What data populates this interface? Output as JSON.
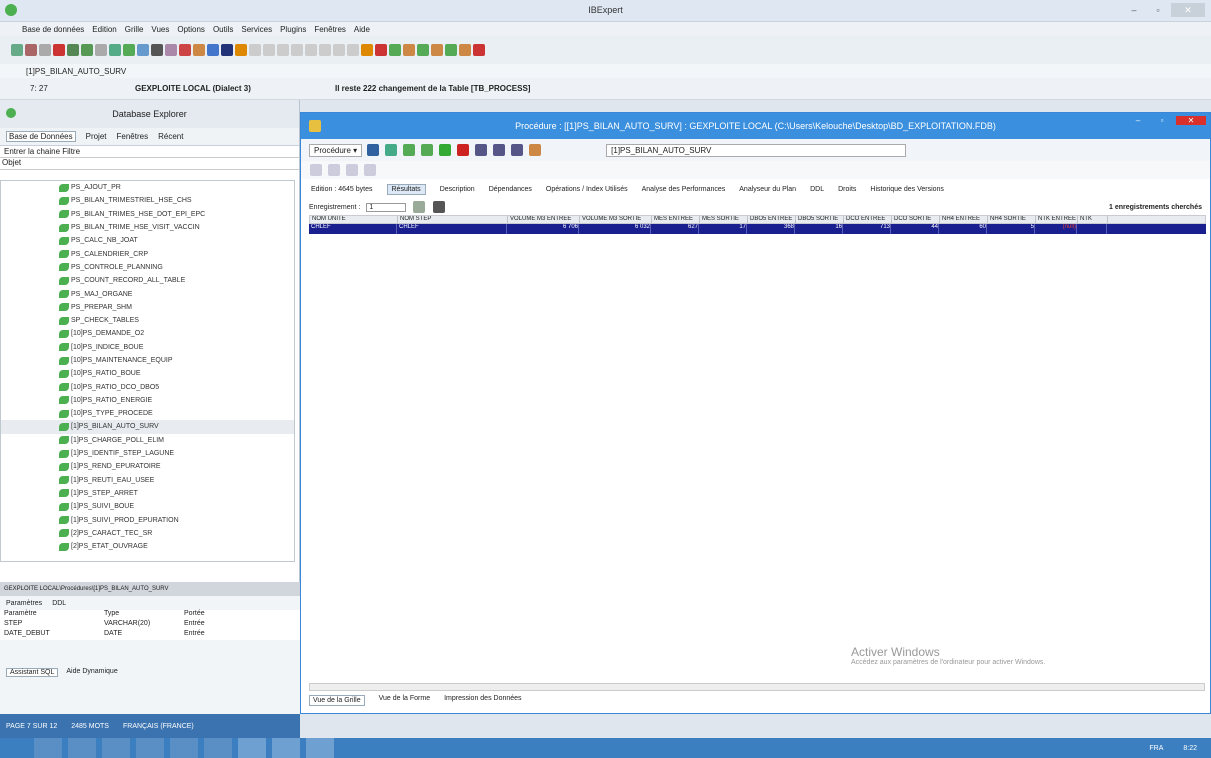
{
  "app": {
    "title": "IBExpert"
  },
  "menu": [
    "Base de données",
    "Edition",
    "Grille",
    "Vues",
    "Options",
    "Outils",
    "Services",
    "Plugins",
    "Fenêtres",
    "Aide"
  ],
  "proc_strip": "[1]PS_BILAN_AUTO_SURV",
  "status_top": {
    "pos": "7: 27",
    "db": "GEXPLOITE LOCAL (Dialect 3)",
    "msg": "Il reste 222 changement de la Table [TB_PROCESS]"
  },
  "dbx": {
    "title": "Database Explorer",
    "tabs": [
      "Base de Données",
      "Projet",
      "Fenêtres",
      "Récent"
    ],
    "filter": "Entrer la chaine Filtre",
    "object_label": "Objet",
    "items": [
      "PS_AJOUT_PR",
      "PS_BILAN_TRIMESTRIEL_HSE_CHS",
      "PS_BILAN_TRIMES_HSE_DOT_EPI_EPC",
      "PS_BILAN_TRIME_HSE_VISIT_VACCIN",
      "PS_CALC_NB_JOAT",
      "PS_CALENDRIER_CRP",
      "PS_CONTROLE_PLANNING",
      "PS_COUNT_RECORD_ALL_TABLE",
      "PS_MAJ_ORGANE",
      "PS_PREPAR_SHM",
      "SP_CHECK_TABLES",
      "[10]PS_DEMANDE_O2",
      "[10]PS_INDICE_BOUE",
      "[10]PS_MAINTENANCE_EQUIP",
      "[10]PS_RATIO_BOUE",
      "[10]PS_RATIO_DCO_DBO5",
      "[10]PS_RATIO_ENERGIE",
      "[10]PS_TYPE_PROCEDE",
      "[1]PS_BILAN_AUTO_SURV",
      "[1]PS_CHARGE_POLL_ELIM",
      "[1]PS_IDENTIF_STEP_LAGUNE",
      "[1]PS_REND_EPURATOIRE",
      "[1]PS_REUTI_EAU_USEE",
      "[1]PS_STEP_ARRET",
      "[1]PS_SUIVI_BOUE",
      "[1]PS_SUIVI_PROD_EPURATION",
      "[2]PS_CARACT_TEC_SR",
      "[2]PS_ETAT_OUVRAGE"
    ],
    "selected_index": 18
  },
  "params": {
    "path": "GEXPLOITE LOCAL\\Procédures\\[1]PS_BILAN_AUTO_SURV",
    "tabs": [
      "Paramètres",
      "DDL"
    ],
    "headers": [
      "Paramètre",
      "Type",
      "Portée"
    ],
    "rows": [
      [
        "STEP",
        "VARCHAR(20)",
        "Entrée"
      ],
      [
        "DATE_DEBUT",
        "DATE",
        "Entrée"
      ]
    ],
    "bottom_tabs": [
      "Assistant SQL",
      "Aide Dynamique"
    ]
  },
  "ws_status": {
    "page": "PAGE 7 SUR 12",
    "words": "2485 MOTS",
    "lang": "FRANÇAIS (FRANCE)"
  },
  "proc": {
    "title": "Procédure : [[1]PS_BILAN_AUTO_SURV] : GEXPLOITE LOCAL (C:\\Users\\Kelouche\\Desktop\\BD_EXPLOITATION.FDB)",
    "combo": "[1]PS_BILAN_AUTO_SURV",
    "menu_label": "Procédure ▾",
    "tabs": [
      "Edition : 4645 bytes",
      "Résultats",
      "Description",
      "Dépendances",
      "Opérations / Index Utilisés",
      "Analyse des Performances",
      "Analyseur du Plan",
      "DDL",
      "Droits",
      "Historique des Versions"
    ],
    "active_tab": 1,
    "record_label": "Enregistrement :",
    "record_value": "1",
    "records_found": "1 enregistrements cherchés",
    "columns": [
      "NOM UNITE",
      "NOM STEP",
      "VOLUME M3 ENTREE",
      "VOLUME M3 SORTIE",
      "MES ENTREE",
      "MES SORTIE",
      "DBO5 ENTREE",
      "DBO5 SORTIE",
      "DCO ENTREE",
      "DCO SORTIE",
      "NH4 ENTREE",
      "NH4 SORTIE",
      "NTK ENTREE",
      "NTK"
    ],
    "row": [
      "CHLEF",
      "CHLEF",
      "6 706",
      "6 032",
      "627",
      "17",
      "368",
      "16",
      "713",
      "44",
      "60",
      "5",
      "(null)",
      ""
    ],
    "bottom_tabs": [
      "Vue de la Grille",
      "Vue de la Forme",
      "Impression des Données"
    ],
    "watermark_title": "Activer Windows",
    "watermark_sub": "Accédez aux paramètres de l'ordinateur pour activer Windows."
  },
  "taskbar": {
    "lang": "FRA",
    "time": "8:22"
  }
}
